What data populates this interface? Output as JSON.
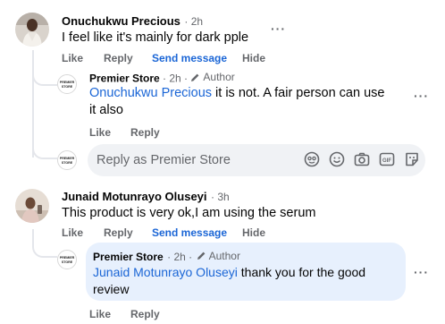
{
  "comments": [
    {
      "author": "Onuchukwu Precious",
      "time": "· 2h",
      "text": "I feel like it's mainly for dark pple",
      "actions": [
        "Like",
        "Reply",
        "Send message",
        "Hide"
      ],
      "reply": {
        "author": "Premier Store",
        "time": "· 2h ·",
        "badge": "Author",
        "mention": "Onuchukwu Precious",
        "text_line1": " it is not. A fair person can use",
        "text_line2": "it also",
        "actions": [
          "Like",
          "Reply"
        ]
      }
    },
    {
      "author": "Junaid Motunrayo Oluseyi",
      "time": "· 3h",
      "text": "This product is very ok,I am using the serum",
      "actions": [
        "Like",
        "Reply",
        "Send message",
        "Hide"
      ],
      "reply": {
        "author": "Premier Store",
        "time": "· 2h ·",
        "badge": "Author",
        "mention": "Junaid Motunrayo Oluseyi",
        "text_line1": " thank you for the good",
        "text_line2": "review",
        "actions": [
          "Like",
          "Reply"
        ]
      }
    }
  ],
  "reply_box": {
    "placeholder": "Reply as Premier Store"
  },
  "store_logo": {
    "line1": "PREMIER",
    "line2": "STORE"
  },
  "colors": {
    "mention": "#1b66d6",
    "secondary": "#65676b",
    "bubble": "#e7f0fd",
    "reply_box": "#f0f2f5"
  }
}
